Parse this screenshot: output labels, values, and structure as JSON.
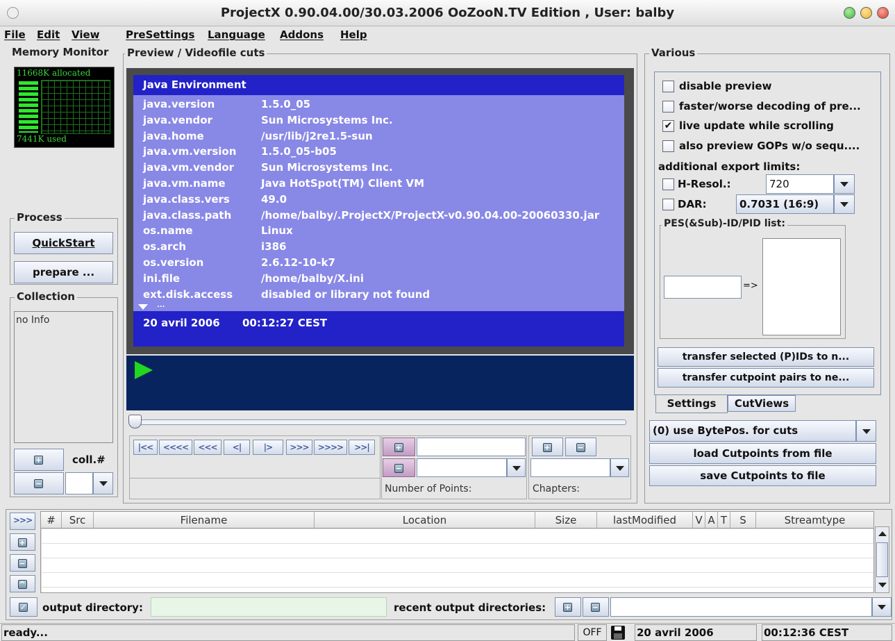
{
  "window": {
    "title": "ProjectX 0.90.04.00/30.03.2006 OoZooN.TV Edition , User: balby"
  },
  "menu": [
    "File",
    "Edit",
    "View",
    "PreSettings",
    "Language",
    "Addons",
    "Help"
  ],
  "memory": {
    "title": "Memory Monitor",
    "allocated": "11668K allocated",
    "used": "7441K used"
  },
  "process": {
    "title": "Process",
    "quickstart": "QuickStart",
    "prepare": "prepare ..."
  },
  "collection": {
    "title": "Collection",
    "info": "no Info",
    "coll_label": "coll.#",
    "coll_value": ""
  },
  "preview": {
    "title": "Preview / Videofile cuts",
    "header": "Java Environment",
    "rows": [
      [
        "java.version",
        "1.5.0_05"
      ],
      [
        "java.vendor",
        "Sun Microsystems Inc."
      ],
      [
        "java.home",
        "/usr/lib/j2re1.5-sun"
      ],
      [
        "java.vm.version",
        "1.5.0_05-b05"
      ],
      [
        "java.vm.vendor",
        "Sun Microsystems Inc."
      ],
      [
        "java.vm.name",
        "Java HotSpot(TM) Client VM"
      ],
      [
        "java.class.vers",
        "49.0"
      ],
      [
        "java.class.path",
        "/home/balby/.ProjectX/ProjectX-v0.90.04.00-20060330.jar"
      ],
      [
        "os.name",
        "Linux"
      ],
      [
        "os.arch",
        "i386"
      ],
      [
        "os.version",
        "2.6.12-10-k7"
      ],
      [
        "ini.file",
        "/home/balby/X.ini"
      ],
      [
        "ext.disk.access",
        "disabled or library not found"
      ]
    ],
    "more": "...",
    "footer_date": "20 avril 2006",
    "footer_time": "00:12:27 CEST"
  },
  "nav": [
    "|<<",
    "<<<<",
    "<<<",
    "<|",
    "|>",
    ">>>",
    ">>>>",
    ">>|"
  ],
  "points": {
    "label": "Number of Points:",
    "input": "",
    "select": ""
  },
  "chapters": {
    "label": "Chapters:",
    "select": ""
  },
  "various": {
    "title": "Various",
    "checks": [
      {
        "label": "disable preview",
        "checked": false
      },
      {
        "label": "faster/worse decoding of pre...",
        "checked": false
      },
      {
        "label": "live update while scrolling",
        "checked": true
      },
      {
        "label": "also preview GOPs w/o sequ....",
        "checked": false
      }
    ],
    "export_title": "additional export limits:",
    "hresol": {
      "label": "H-Resol.:",
      "value": "720",
      "checked": false
    },
    "dar": {
      "label": "DAR:",
      "value": "0.7031 (16:9)",
      "checked": false
    },
    "pes_title": "PES(&Sub)-ID/PID list:",
    "pes_input": "",
    "arrow": "=>",
    "transfer_pids": "transfer selected (P)IDs to n...",
    "transfer_cut": "transfer cutpoint pairs to ne...",
    "tabs": [
      "Settings",
      "CutViews"
    ],
    "cut_mode": "(0) use BytePos. for cuts",
    "load": "load Cutpoints from file",
    "save": "save Cutpoints to file"
  },
  "table": {
    "columns": [
      "#",
      "Src",
      "Filename",
      "Location",
      "Size",
      "lastModified",
      "V",
      "A",
      "T",
      "S",
      "Streamtype"
    ],
    "rows": []
  },
  "output": {
    "label": "output directory:",
    "value": "",
    "recent_label": "recent output directories:",
    "recent_value": ""
  },
  "status": {
    "text": "ready...",
    "mode": "OFF",
    "date": "20 avril 2006",
    "time": "00:12:36 CEST"
  },
  "colors": {
    "preview_bg": "#8888e6",
    "preview_header": "#2222c8",
    "player_bg": "#08245e",
    "play": "#22d622",
    "close_red": "#e23a2a",
    "min_yellow": "#f0b428",
    "max_green": "#3cba3c"
  }
}
